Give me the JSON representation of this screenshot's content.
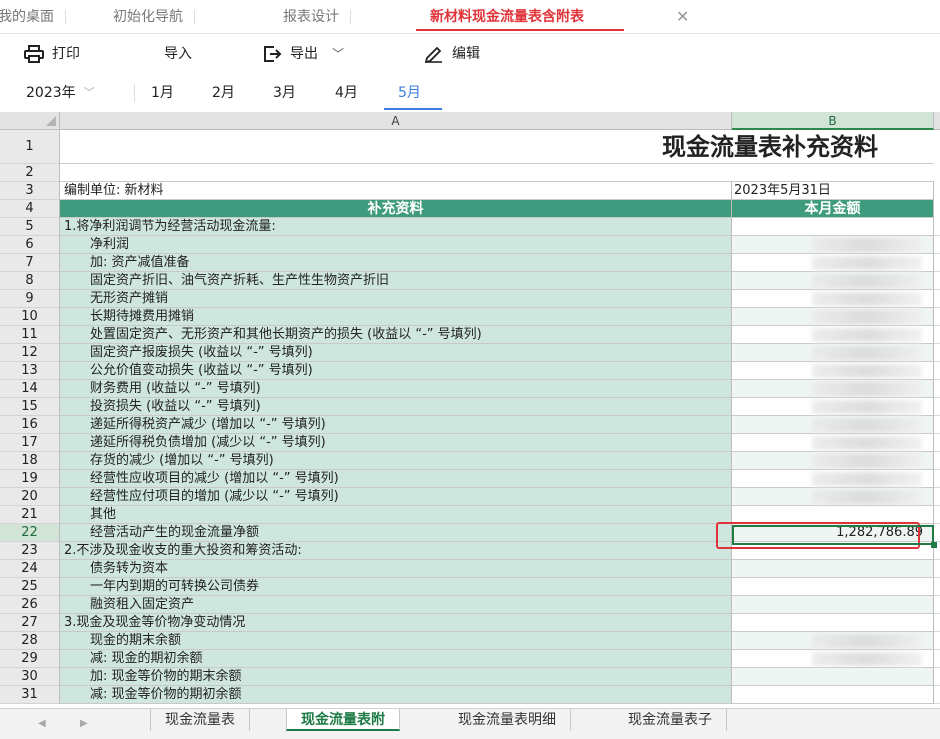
{
  "tabs": [
    {
      "label": "我的桌面",
      "active": false
    },
    {
      "label": "初始化导航",
      "active": false
    },
    {
      "label": "报表设计",
      "active": false
    },
    {
      "label": "新材料现金流量表含附表",
      "active": true
    }
  ],
  "toolbar": {
    "print": "打印",
    "import": "导入",
    "export": "导出",
    "edit": "编辑"
  },
  "period": {
    "year": "2023年",
    "months": [
      "1月",
      "2月",
      "3月",
      "4月",
      "5月"
    ],
    "active_month": "5月"
  },
  "sheet": {
    "columns": [
      "A",
      "B"
    ],
    "title": "现金流量表补充资料",
    "unit_label": "编制单位: 新材料",
    "date": "2023年5月31日",
    "header_a": "补充资料",
    "header_b": "本月金额",
    "rows": [
      {
        "n": "5",
        "text": "1.将净利润调节为经营活动现金流量:",
        "style": "sec"
      },
      {
        "n": "6",
        "text": "净利润",
        "style": "ind"
      },
      {
        "n": "7",
        "text": "加: 资产减值准备",
        "style": "ind"
      },
      {
        "n": "8",
        "text": "固定资产折旧、油气资产折耗、生产性生物资产折旧",
        "style": "ind"
      },
      {
        "n": "9",
        "text": "无形资产摊销",
        "style": "ind"
      },
      {
        "n": "10",
        "text": "长期待摊费用摊销",
        "style": "ind"
      },
      {
        "n": "11",
        "text": "处置固定资产、无形资产和其他长期资产的损失 (收益以 “-” 号填列)",
        "style": "ind"
      },
      {
        "n": "12",
        "text": "固定资产报废损失 (收益以 “-” 号填列)",
        "style": "ind"
      },
      {
        "n": "13",
        "text": "公允价值变动损失 (收益以 “-” 号填列)",
        "style": "ind"
      },
      {
        "n": "14",
        "text": "财务费用 (收益以 “-” 号填列)",
        "style": "ind"
      },
      {
        "n": "15",
        "text": "投资损失 (收益以 “-” 号填列)",
        "style": "ind"
      },
      {
        "n": "16",
        "text": "递延所得税资产减少 (增加以 “-” 号填列)",
        "style": "ind"
      },
      {
        "n": "17",
        "text": "递延所得税负债增加 (减少以 “-” 号填列)",
        "style": "ind"
      },
      {
        "n": "18",
        "text": "存货的减少 (增加以 “-” 号填列)",
        "style": "ind"
      },
      {
        "n": "19",
        "text": "经营性应收项目的减少 (增加以 “-” 号填列)",
        "style": "ind"
      },
      {
        "n": "20",
        "text": "经营性应付项目的增加 (减少以 “-” 号填列)",
        "style": "ind"
      },
      {
        "n": "21",
        "text": "其他",
        "style": "ind"
      },
      {
        "n": "22",
        "text": "经营活动产生的现金流量净额",
        "style": "ind",
        "value": "1,282,786.89",
        "selected": true
      },
      {
        "n": "23",
        "text": "2.不涉及现金收支的重大投资和筹资活动:",
        "style": "sec"
      },
      {
        "n": "24",
        "text": "债务转为资本",
        "style": "ind"
      },
      {
        "n": "25",
        "text": "一年内到期的可转换公司债券",
        "style": "ind"
      },
      {
        "n": "26",
        "text": "融资租入固定资产",
        "style": "ind"
      },
      {
        "n": "27",
        "text": "3.现金及现金等价物净变动情况",
        "style": "sec"
      },
      {
        "n": "28",
        "text": "现金的期末余额",
        "style": "ind"
      },
      {
        "n": "29",
        "text": "减: 现金的期初余额",
        "style": "ind"
      },
      {
        "n": "30",
        "text": "加: 现金等价物的期末余额",
        "style": "ind"
      },
      {
        "n": "31",
        "text": "减: 现金等价物的期初余额",
        "style": "ind"
      }
    ]
  },
  "sheet_tabs": [
    {
      "label": "现金流量表",
      "active": false
    },
    {
      "label": "现金流量表附",
      "active": true
    },
    {
      "label": "现金流量表明细",
      "active": false
    },
    {
      "label": "现金流量表子",
      "active": false
    }
  ],
  "colors": {
    "accent_red": "#e0343b",
    "header_green": "#3f9b7e",
    "cell_green": "#cfe6de",
    "active_blue": "#3a7ce0"
  }
}
